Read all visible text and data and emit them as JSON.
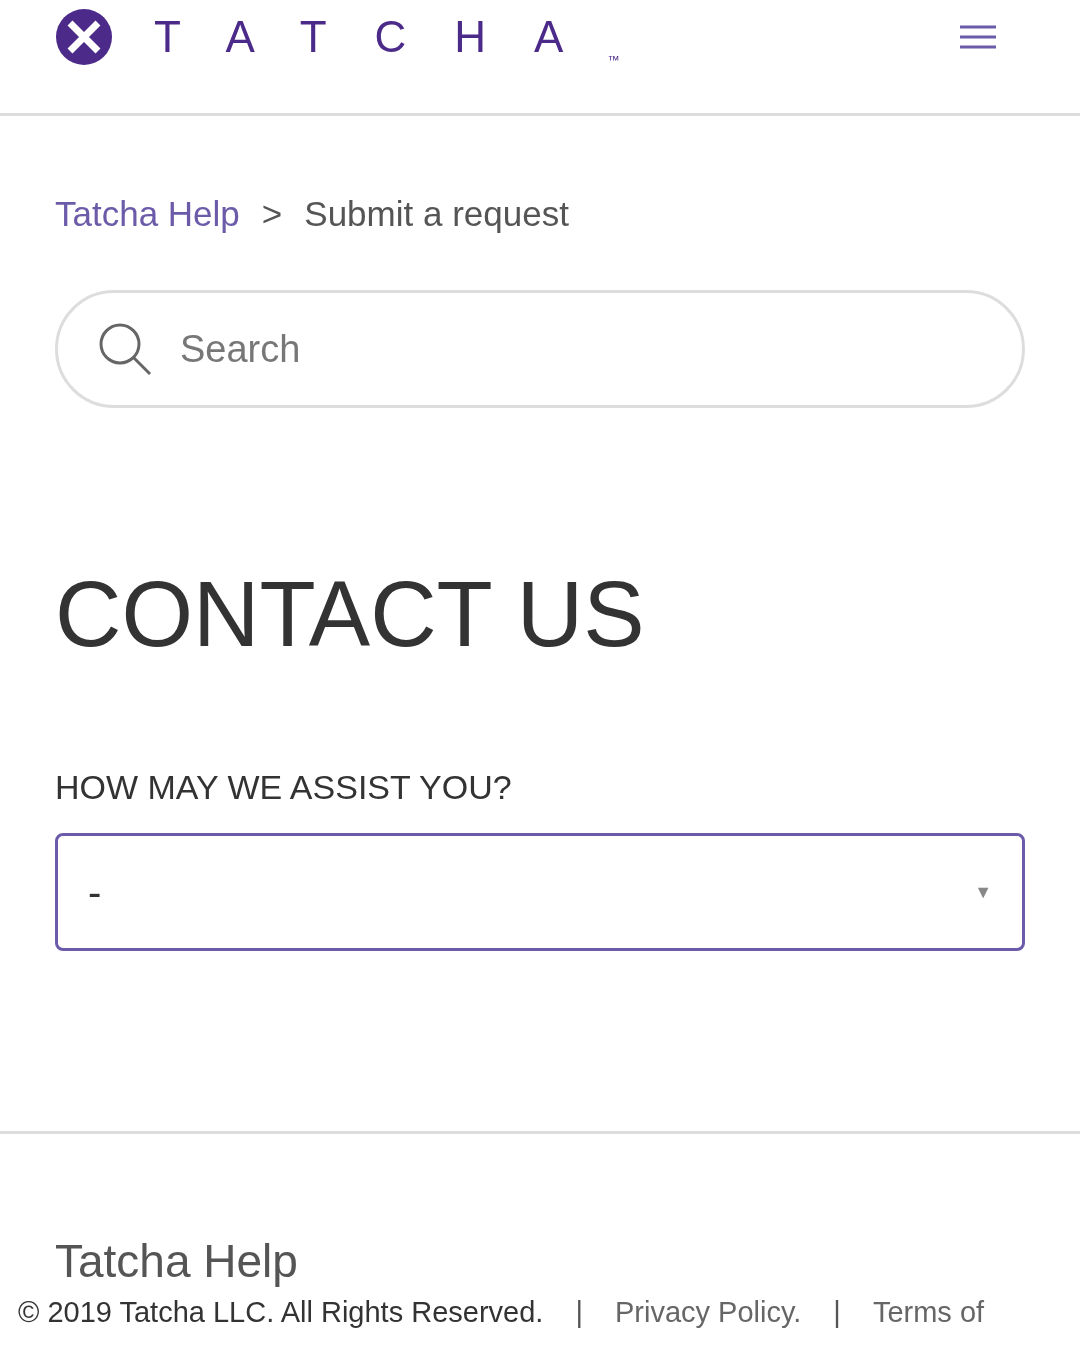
{
  "header": {
    "logo": "TATCHA",
    "trademark": "™"
  },
  "breadcrumb": {
    "separator": ">",
    "items": [
      {
        "label": "Tatcha Help",
        "kind": "link"
      },
      {
        "label": "Submit a request",
        "kind": "current"
      }
    ]
  },
  "search": {
    "placeholder": "Search"
  },
  "heading": "CONTACT US",
  "form": {
    "label": "HOW MAY WE ASSIST YOU?",
    "select": {
      "value": "-",
      "caret": "▼"
    }
  },
  "footer": {
    "title": "Tatcha Help",
    "items": [
      {
        "kind": "text",
        "label": "© 2019 Tatcha LLC. All Rights Reserved."
      },
      {
        "kind": "separator",
        "label": "|"
      },
      {
        "kind": "link",
        "label": "Privacy Policy."
      },
      {
        "kind": "separator",
        "label": "|"
      },
      {
        "kind": "link",
        "label": "Terms of"
      }
    ]
  }
}
